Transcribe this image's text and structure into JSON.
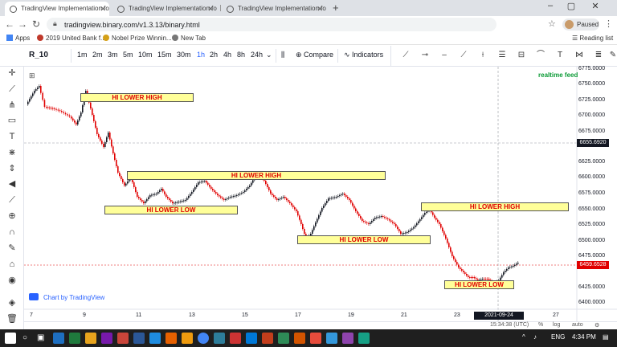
{
  "browser": {
    "tabs": [
      {
        "title": "TradingView Implementation for"
      },
      {
        "title": "TradingView Implementation for"
      },
      {
        "title": "TradingView Implementation for"
      }
    ],
    "url": "tradingview.binary.com/v1.3.13/binary.html",
    "profile_label": "Paused",
    "bookmarks": [
      "Apps",
      "2019 United Bank f...",
      "Nobel Prize Winnin...",
      "New Tab"
    ],
    "reading_list": "Reading list"
  },
  "toolbar": {
    "symbol": "R_10",
    "timeframes": [
      "1m",
      "2m",
      "3m",
      "5m",
      "10m",
      "15m",
      "30m",
      "1h",
      "2h",
      "4h",
      "8h",
      "24h"
    ],
    "selected_timeframe": "1h",
    "compare_label": "Compare",
    "indicators_label": "Indicators"
  },
  "chart": {
    "realtime_label": "realtime feed",
    "watermark": "Chart by TradingView",
    "current_price": "6459.6528",
    "crosshair_price": "6655.6920",
    "crosshair_time": "2021-09-24 14:00:00",
    "price_ticks": [
      "6775.0000",
      "6750.0000",
      "6725.0000",
      "6700.0000",
      "6675.0000",
      "6650.0000",
      "6625.0000",
      "6600.0000",
      "6575.0000",
      "6550.0000",
      "6525.0000",
      "6500.0000",
      "6475.0000",
      "6450.0000",
      "6425.0000",
      "6400.0000"
    ],
    "date_ticks": [
      "7",
      "9",
      "11",
      "13",
      "15",
      "17",
      "19",
      "21",
      "23",
      "27"
    ],
    "annotations": [
      "HI LOWER HIGH",
      "HI LOWER HIGH",
      "HI LOWER LOW",
      "HI LOWER LOW",
      "HI LOWER HIGH",
      "HI LOWER LOW"
    ]
  },
  "status": {
    "time": "15:34:38 (UTC)",
    "percent": "%",
    "log": "log",
    "auto": "auto"
  },
  "taskbar": {
    "lang": "ENG",
    "clock": "4:34 PM"
  },
  "colors": {
    "bull": "#131722",
    "bear": "#e00000",
    "box_fill": "#ffff99",
    "accent": "#2962ff"
  }
}
